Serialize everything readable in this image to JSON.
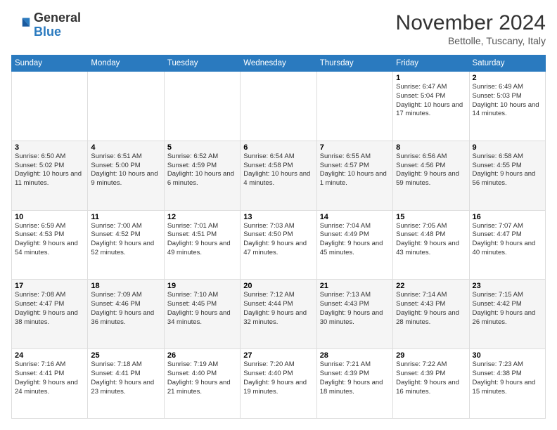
{
  "logo": {
    "general": "General",
    "blue": "Blue"
  },
  "header": {
    "month_title": "November 2024",
    "subtitle": "Bettolle, Tuscany, Italy"
  },
  "days_of_week": [
    "Sunday",
    "Monday",
    "Tuesday",
    "Wednesday",
    "Thursday",
    "Friday",
    "Saturday"
  ],
  "weeks": [
    [
      {
        "day": "",
        "info": ""
      },
      {
        "day": "",
        "info": ""
      },
      {
        "day": "",
        "info": ""
      },
      {
        "day": "",
        "info": ""
      },
      {
        "day": "",
        "info": ""
      },
      {
        "day": "1",
        "info": "Sunrise: 6:47 AM\nSunset: 5:04 PM\nDaylight: 10 hours and 17 minutes."
      },
      {
        "day": "2",
        "info": "Sunrise: 6:49 AM\nSunset: 5:03 PM\nDaylight: 10 hours and 14 minutes."
      }
    ],
    [
      {
        "day": "3",
        "info": "Sunrise: 6:50 AM\nSunset: 5:02 PM\nDaylight: 10 hours and 11 minutes."
      },
      {
        "day": "4",
        "info": "Sunrise: 6:51 AM\nSunset: 5:00 PM\nDaylight: 10 hours and 9 minutes."
      },
      {
        "day": "5",
        "info": "Sunrise: 6:52 AM\nSunset: 4:59 PM\nDaylight: 10 hours and 6 minutes."
      },
      {
        "day": "6",
        "info": "Sunrise: 6:54 AM\nSunset: 4:58 PM\nDaylight: 10 hours and 4 minutes."
      },
      {
        "day": "7",
        "info": "Sunrise: 6:55 AM\nSunset: 4:57 PM\nDaylight: 10 hours and 1 minute."
      },
      {
        "day": "8",
        "info": "Sunrise: 6:56 AM\nSunset: 4:56 PM\nDaylight: 9 hours and 59 minutes."
      },
      {
        "day": "9",
        "info": "Sunrise: 6:58 AM\nSunset: 4:55 PM\nDaylight: 9 hours and 56 minutes."
      }
    ],
    [
      {
        "day": "10",
        "info": "Sunrise: 6:59 AM\nSunset: 4:53 PM\nDaylight: 9 hours and 54 minutes."
      },
      {
        "day": "11",
        "info": "Sunrise: 7:00 AM\nSunset: 4:52 PM\nDaylight: 9 hours and 52 minutes."
      },
      {
        "day": "12",
        "info": "Sunrise: 7:01 AM\nSunset: 4:51 PM\nDaylight: 9 hours and 49 minutes."
      },
      {
        "day": "13",
        "info": "Sunrise: 7:03 AM\nSunset: 4:50 PM\nDaylight: 9 hours and 47 minutes."
      },
      {
        "day": "14",
        "info": "Sunrise: 7:04 AM\nSunset: 4:49 PM\nDaylight: 9 hours and 45 minutes."
      },
      {
        "day": "15",
        "info": "Sunrise: 7:05 AM\nSunset: 4:48 PM\nDaylight: 9 hours and 43 minutes."
      },
      {
        "day": "16",
        "info": "Sunrise: 7:07 AM\nSunset: 4:47 PM\nDaylight: 9 hours and 40 minutes."
      }
    ],
    [
      {
        "day": "17",
        "info": "Sunrise: 7:08 AM\nSunset: 4:47 PM\nDaylight: 9 hours and 38 minutes."
      },
      {
        "day": "18",
        "info": "Sunrise: 7:09 AM\nSunset: 4:46 PM\nDaylight: 9 hours and 36 minutes."
      },
      {
        "day": "19",
        "info": "Sunrise: 7:10 AM\nSunset: 4:45 PM\nDaylight: 9 hours and 34 minutes."
      },
      {
        "day": "20",
        "info": "Sunrise: 7:12 AM\nSunset: 4:44 PM\nDaylight: 9 hours and 32 minutes."
      },
      {
        "day": "21",
        "info": "Sunrise: 7:13 AM\nSunset: 4:43 PM\nDaylight: 9 hours and 30 minutes."
      },
      {
        "day": "22",
        "info": "Sunrise: 7:14 AM\nSunset: 4:43 PM\nDaylight: 9 hours and 28 minutes."
      },
      {
        "day": "23",
        "info": "Sunrise: 7:15 AM\nSunset: 4:42 PM\nDaylight: 9 hours and 26 minutes."
      }
    ],
    [
      {
        "day": "24",
        "info": "Sunrise: 7:16 AM\nSunset: 4:41 PM\nDaylight: 9 hours and 24 minutes."
      },
      {
        "day": "25",
        "info": "Sunrise: 7:18 AM\nSunset: 4:41 PM\nDaylight: 9 hours and 23 minutes."
      },
      {
        "day": "26",
        "info": "Sunrise: 7:19 AM\nSunset: 4:40 PM\nDaylight: 9 hours and 21 minutes."
      },
      {
        "day": "27",
        "info": "Sunrise: 7:20 AM\nSunset: 4:40 PM\nDaylight: 9 hours and 19 minutes."
      },
      {
        "day": "28",
        "info": "Sunrise: 7:21 AM\nSunset: 4:39 PM\nDaylight: 9 hours and 18 minutes."
      },
      {
        "day": "29",
        "info": "Sunrise: 7:22 AM\nSunset: 4:39 PM\nDaylight: 9 hours and 16 minutes."
      },
      {
        "day": "30",
        "info": "Sunrise: 7:23 AM\nSunset: 4:38 PM\nDaylight: 9 hours and 15 minutes."
      }
    ]
  ]
}
